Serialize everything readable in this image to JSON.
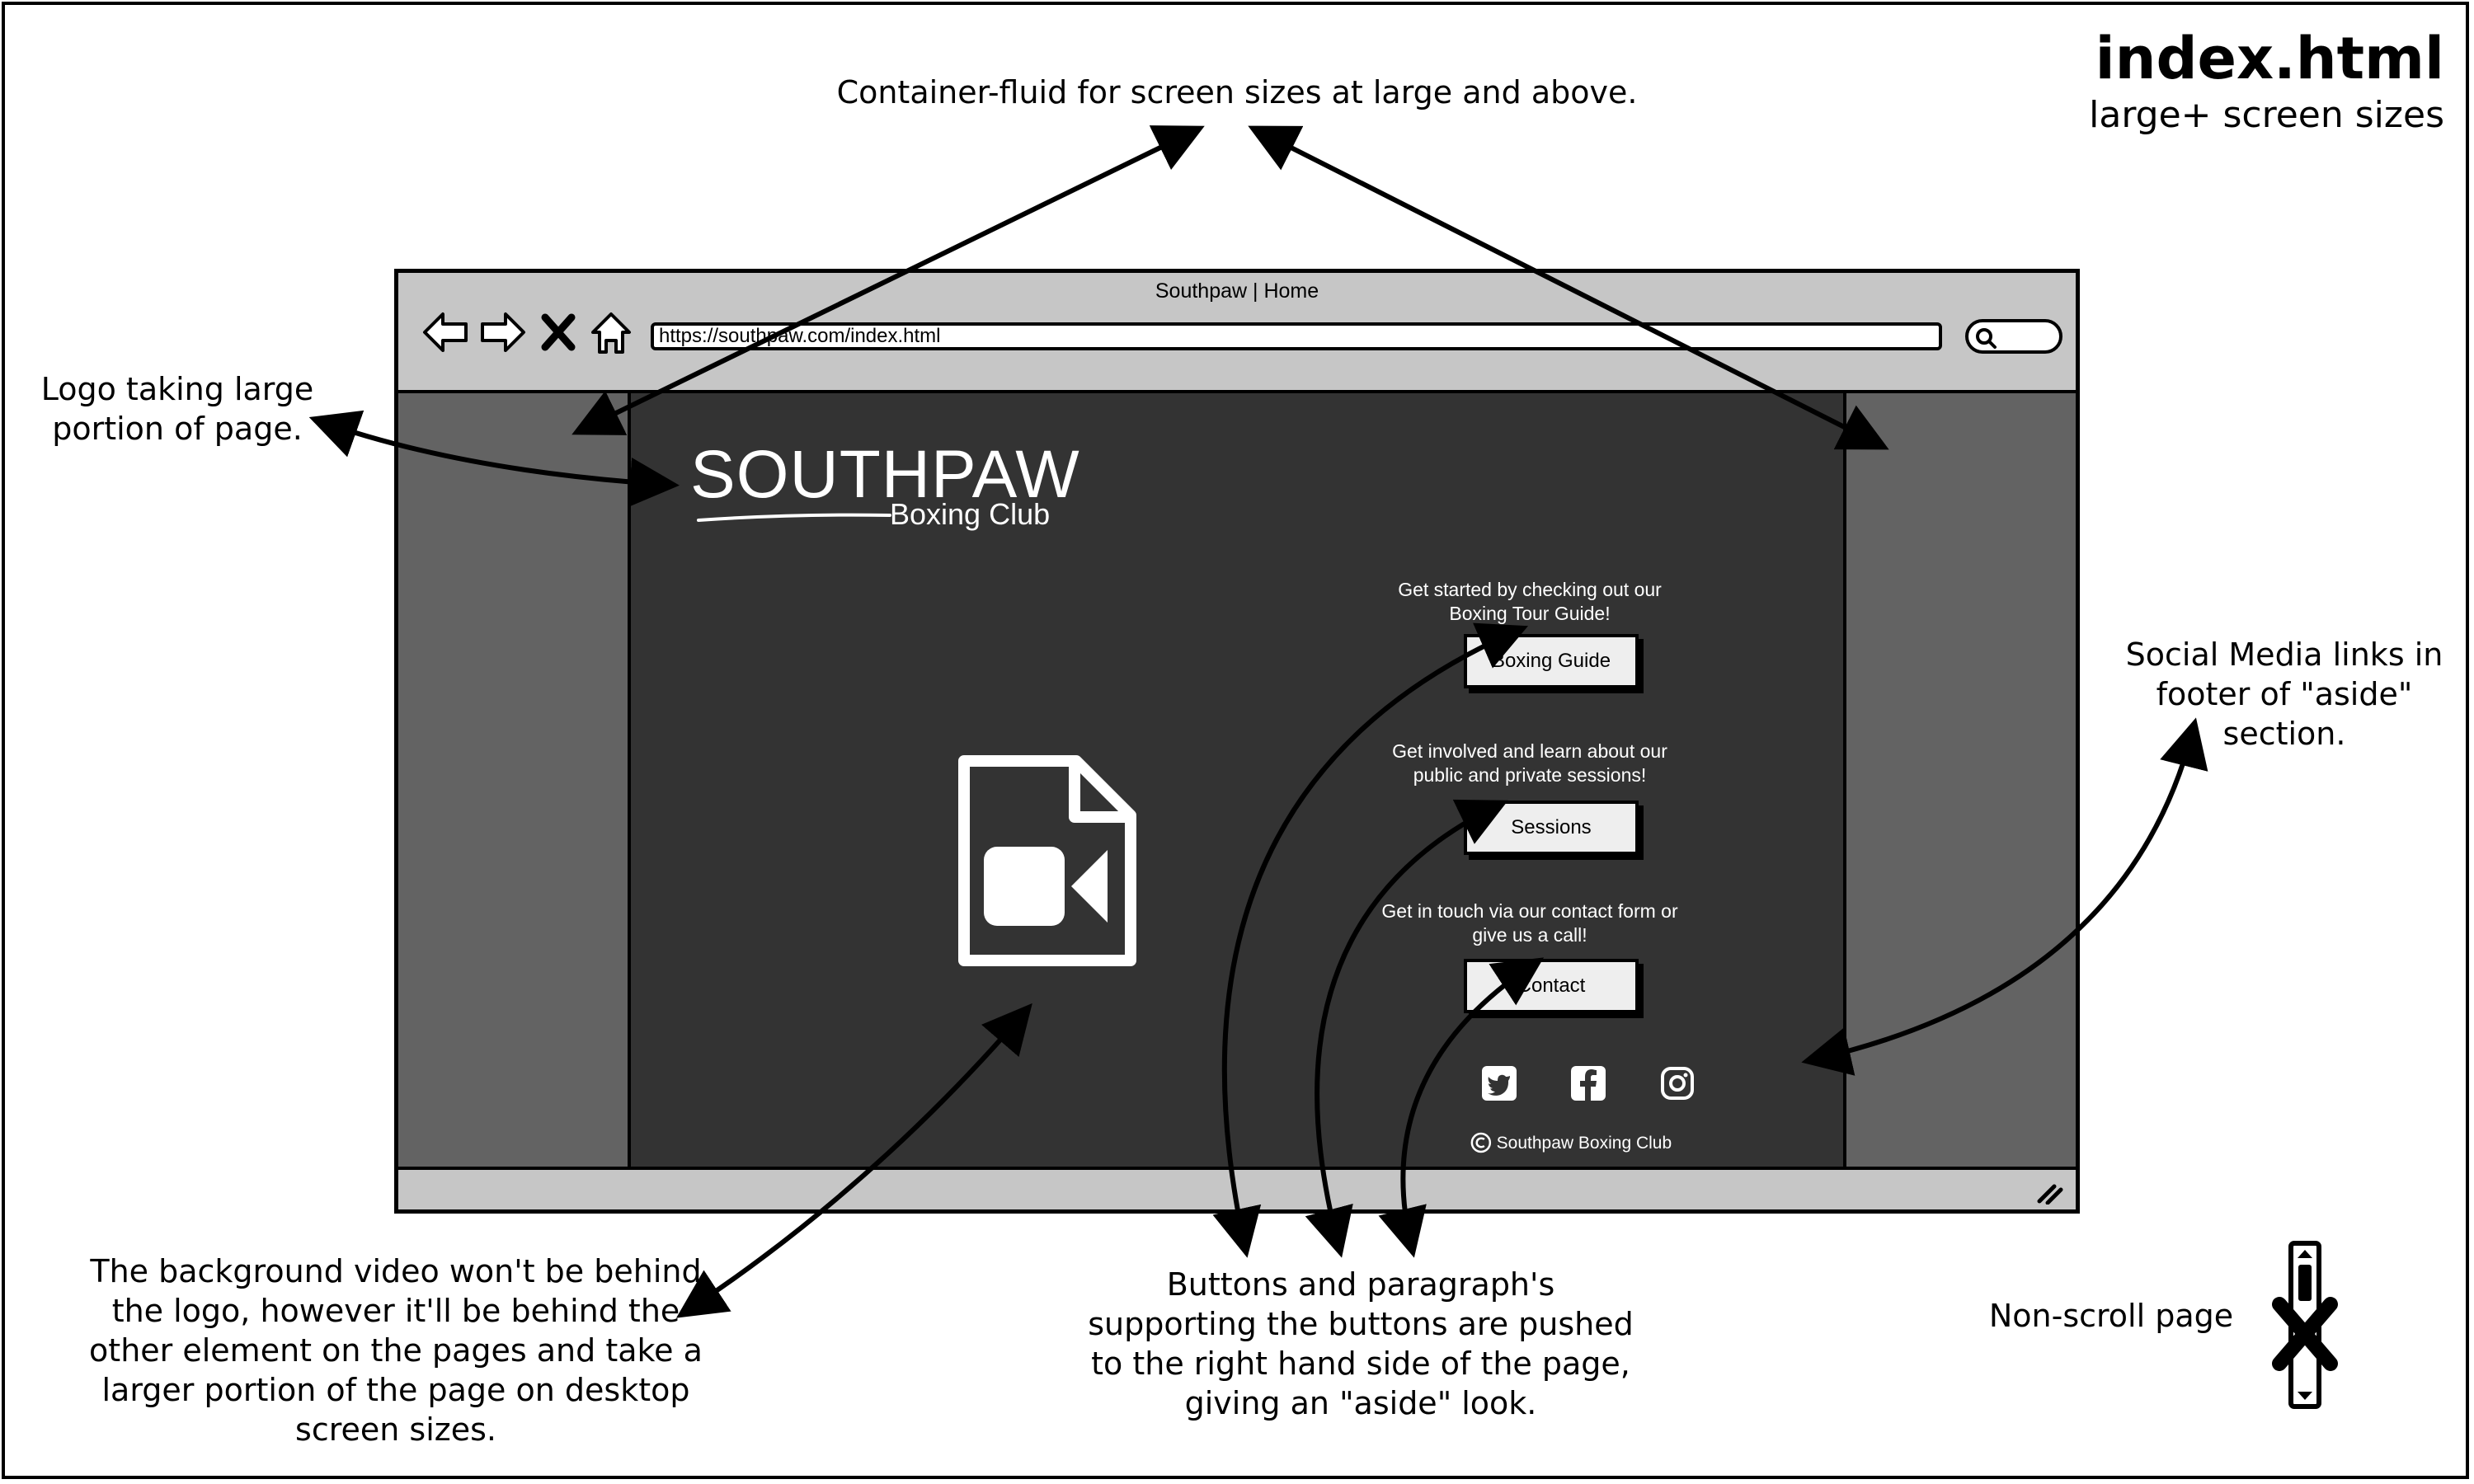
{
  "heading": {
    "title": "index.html",
    "subtitle": "large+ screen sizes"
  },
  "annotations": {
    "container": "Container-fluid for screen sizes at large and above.",
    "logo": [
      "Logo taking large",
      "portion of page."
    ],
    "social": [
      "Social Media links in",
      "footer of \"aside\"",
      "section."
    ],
    "video": [
      "The background video won't be behind",
      "the logo, however it'll be behind the",
      "other element on the pages and take a",
      "larger portion of the page on desktop",
      "screen sizes."
    ],
    "buttons": [
      "Buttons and paragraph's",
      "supporting the buttons are pushed",
      "to the right hand side of the page,",
      "giving an \"aside\" look."
    ],
    "scroll": "Non-scroll page"
  },
  "browser": {
    "title": "Southpaw | Home",
    "url": "https://southpaw.com/index.html"
  },
  "logo": {
    "main": "SOUTHPAW",
    "sub": "Boxing Club"
  },
  "aside": {
    "items": [
      {
        "text": [
          "Get started by checking out our",
          "Boxing Tour Guide!"
        ],
        "button": "Boxing Guide"
      },
      {
        "text": [
          "Get involved and learn about our",
          "public and private sessions!"
        ],
        "button": "Sessions"
      },
      {
        "text": [
          "Get in touch via our contact form or",
          "give us a call!"
        ],
        "button": "Contact"
      }
    ],
    "social_icons": [
      "twitter-icon",
      "facebook-icon",
      "instagram-icon"
    ],
    "copyright": "Southpaw Boxing Club"
  }
}
